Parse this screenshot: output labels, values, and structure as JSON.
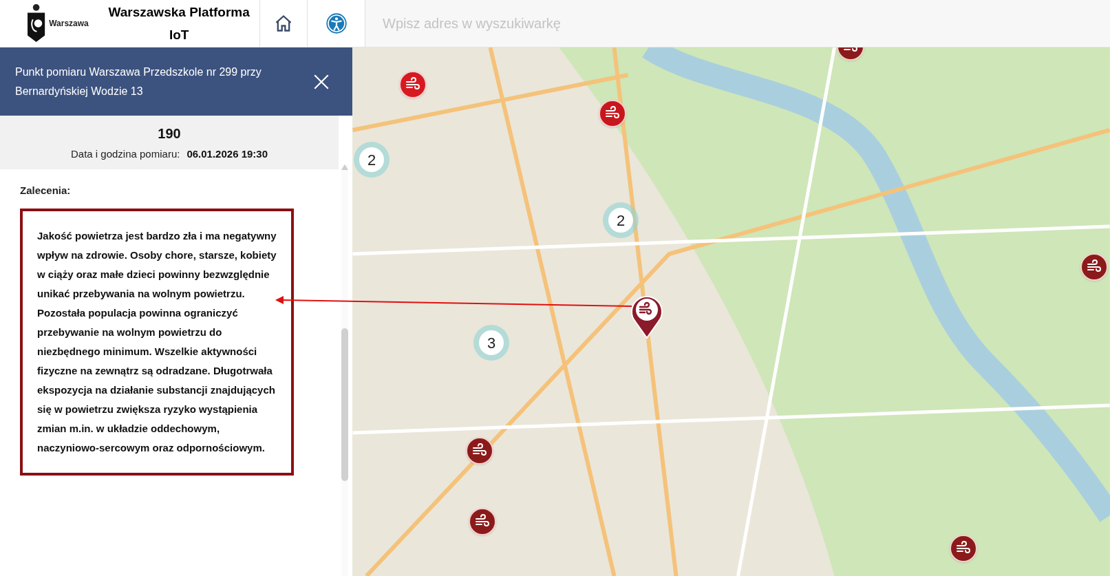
{
  "header": {
    "logo_text": "Warszawa",
    "title": "Warszawska Platforma IoT",
    "search": {
      "placeholder": "Wpisz adres w wyszukiwarkę"
    }
  },
  "panel": {
    "title": "Punkt pomiaru Warszawa Przedszkole nr 299 przy Bernardyńskiej Wodzie 13",
    "value": "190",
    "date_label": "Data i godzina pomiaru:",
    "date_value": "06.01.2026 19:30",
    "section_label": "Zalecenia:",
    "recommendation": "Jakość powietrza jest bardzo zła i ma negatywny wpływ na zdrowie. Osoby chore, starsze, kobiety w ciąży oraz małe dzieci powinny bezwzględnie unikać przebywania na wolnym powietrzu. Pozostała populacja powinna ograniczyć przebywanie na wolnym powietrzu do niezbędnego minimum. Wszelkie aktywności fizyczne na zewnątrz są odradzane. Długotrwała ekspozycja na działanie substancji znajdujących się w powietrzu zwiększa ryzyko wystąpienia zmian m.in. w układzie oddechowym, naczyniowo-sercowym oraz odpornościowym."
  },
  "map": {
    "markers": [
      {
        "kind": "sensor",
        "color": "#d71920"
      },
      {
        "kind": "sensor",
        "color": "#c8161d"
      },
      {
        "kind": "sensor",
        "color": "#8b1a1a"
      },
      {
        "kind": "sensor",
        "color": "#8b1a1a"
      },
      {
        "kind": "sensor",
        "color": "#8b1a1a"
      },
      {
        "kind": "sensor",
        "color": "#8b1a1a"
      },
      {
        "kind": "sensor",
        "color": "#8b1a1a"
      },
      {
        "kind": "cluster",
        "count": "2"
      },
      {
        "kind": "cluster",
        "count": "3"
      },
      {
        "kind": "cluster",
        "count": "2"
      },
      {
        "kind": "selected",
        "color": "#8b1a2a"
      }
    ]
  }
}
